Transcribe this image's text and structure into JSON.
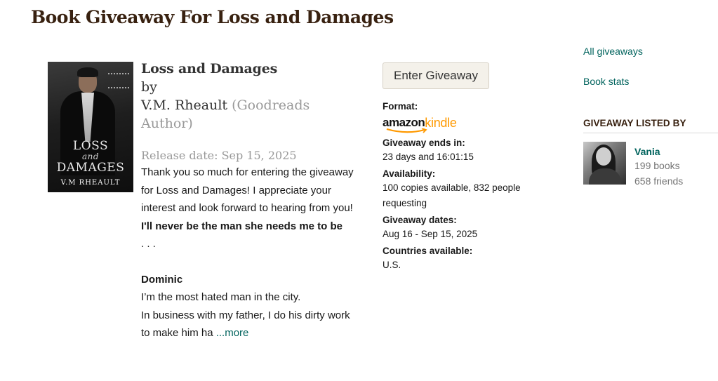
{
  "page": {
    "title": "Book Giveaway For Loss and Damages"
  },
  "cover": {
    "title_line1": "LOSS",
    "title_line2": "and",
    "title_line3": "DAMAGES",
    "author": "V.M RHEAULT"
  },
  "book": {
    "title": "Loss and Damages",
    "by_label": "by",
    "author": "V.M. Rheault",
    "author_badge": "(Goodreads Author)",
    "release_date": "Release date: Sep 15, 2025",
    "description": {
      "para1": "Thank you so much for entering the giveaway for Loss and Damages! I appreciate your interest and look forward to hearing from you!",
      "bold_line": "I'll never be the man she needs me to be",
      "ellipsis": ". . .",
      "heading": "Dominic",
      "line1": "I’m the most hated man in the city.",
      "line2": "In business with my father, I do his dirty work to make him ha",
      "more_link": "...more"
    }
  },
  "giveaway": {
    "enter_button": "Enter Giveaway",
    "format_label": "Format:",
    "format_logo_amazon": "amazon",
    "format_logo_kindle": "kindle",
    "ends_label": "Giveaway ends in:",
    "ends_value": "23 days and 16:01:15",
    "availability_label": "Availability:",
    "availability_value": "100 copies available, 832 people requesting",
    "dates_label": "Giveaway dates:",
    "dates_value": "Aug 16 - Sep 15, 2025",
    "countries_label": "Countries available:",
    "countries_value": "U.S."
  },
  "sidebar": {
    "all_giveaways": "All giveaways",
    "book_stats": "Book stats",
    "listed_by_heading": "GIVEAWAY LISTED BY",
    "lister_name": "Vania",
    "lister_books": "199 books",
    "lister_friends": "658 friends"
  },
  "colors": {
    "title_brown": "#382110",
    "link_green": "#00635d",
    "muted_gray": "#999999",
    "kindle_orange": "#ff9900",
    "button_bg": "#f4f1ea"
  }
}
